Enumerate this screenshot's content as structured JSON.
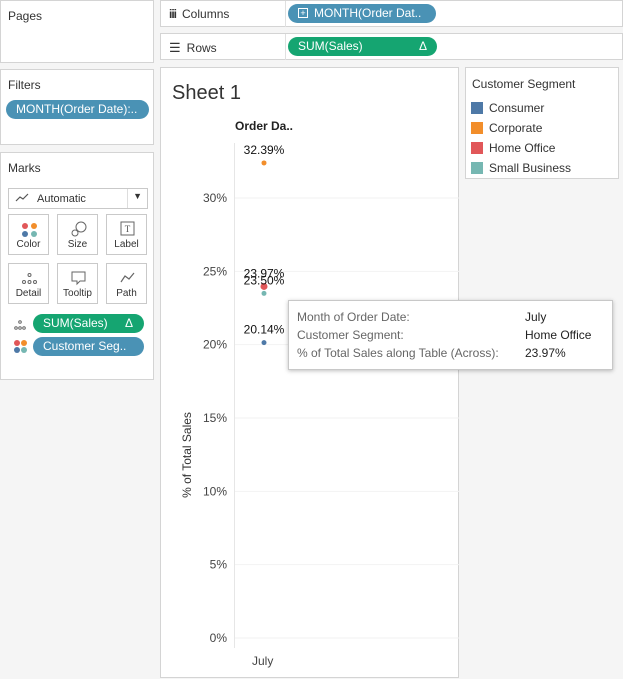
{
  "pages_panel": {
    "title": "Pages"
  },
  "columns_shelf": {
    "label": "Columns",
    "pill": "MONTH(Order Dat.."
  },
  "rows_shelf": {
    "label": "Rows",
    "pill": "SUM(Sales)",
    "pill_delta": "Δ"
  },
  "filters_panel": {
    "title": "Filters",
    "pill": "MONTH(Order Date):.."
  },
  "marks_panel": {
    "title": "Marks",
    "dropdown_value": "Automatic",
    "buttons": [
      {
        "label": "Color",
        "icon": "color-icon"
      },
      {
        "label": "Size",
        "icon": "size-icon"
      },
      {
        "label": "Label",
        "icon": "label-icon"
      },
      {
        "label": "Detail",
        "icon": "detail-icon"
      },
      {
        "label": "Tooltip",
        "icon": "tooltip-icon"
      },
      {
        "label": "Path",
        "icon": "path-icon"
      }
    ],
    "cards": [
      {
        "label": "SUM(Sales)",
        "delta": "Δ"
      },
      {
        "label": "Customer Seg.."
      }
    ]
  },
  "sheet": {
    "title": "Sheet 1",
    "column_header": "Order Da..",
    "y_axis_label": "% of Total Sales",
    "x_tick": "July"
  },
  "legend": {
    "title": "Customer Segment",
    "items": [
      {
        "label": "Consumer",
        "color": "#4e79a7"
      },
      {
        "label": "Corporate",
        "color": "#f28e2b"
      },
      {
        "label": "Home Office",
        "color": "#e15759"
      },
      {
        "label": "Small Business",
        "color": "#76b7b2"
      }
    ]
  },
  "tooltip": {
    "rows": [
      {
        "key": "Month of Order Date:",
        "value": "July"
      },
      {
        "key": "Customer Segment:",
        "value": "Home Office"
      },
      {
        "key": "% of Total Sales along Table (Across):",
        "value": "23.97%"
      }
    ]
  },
  "chart_data": {
    "type": "scatter",
    "categories": [
      "July"
    ],
    "ylabel": "% of Total Sales",
    "xlabel": "",
    "ylim": [
      0,
      34
    ],
    "yticks": [
      "0%",
      "5%",
      "10%",
      "15%",
      "20%",
      "25%",
      "30%"
    ],
    "ytick_values": [
      0,
      5,
      10,
      15,
      20,
      25,
      30
    ],
    "series": [
      {
        "name": "Corporate",
        "values": [
          32.39
        ],
        "label": "32.39%",
        "color": "#f28e2b"
      },
      {
        "name": "Home Office",
        "values": [
          23.97
        ],
        "label": "23.97%",
        "color": "#e15759"
      },
      {
        "name": "Small Business",
        "values": [
          23.5
        ],
        "label": "23.50%",
        "color": "#76b7b2"
      },
      {
        "name": "Consumer",
        "values": [
          20.14
        ],
        "label": "20.14%",
        "color": "#4e79a7"
      }
    ]
  }
}
